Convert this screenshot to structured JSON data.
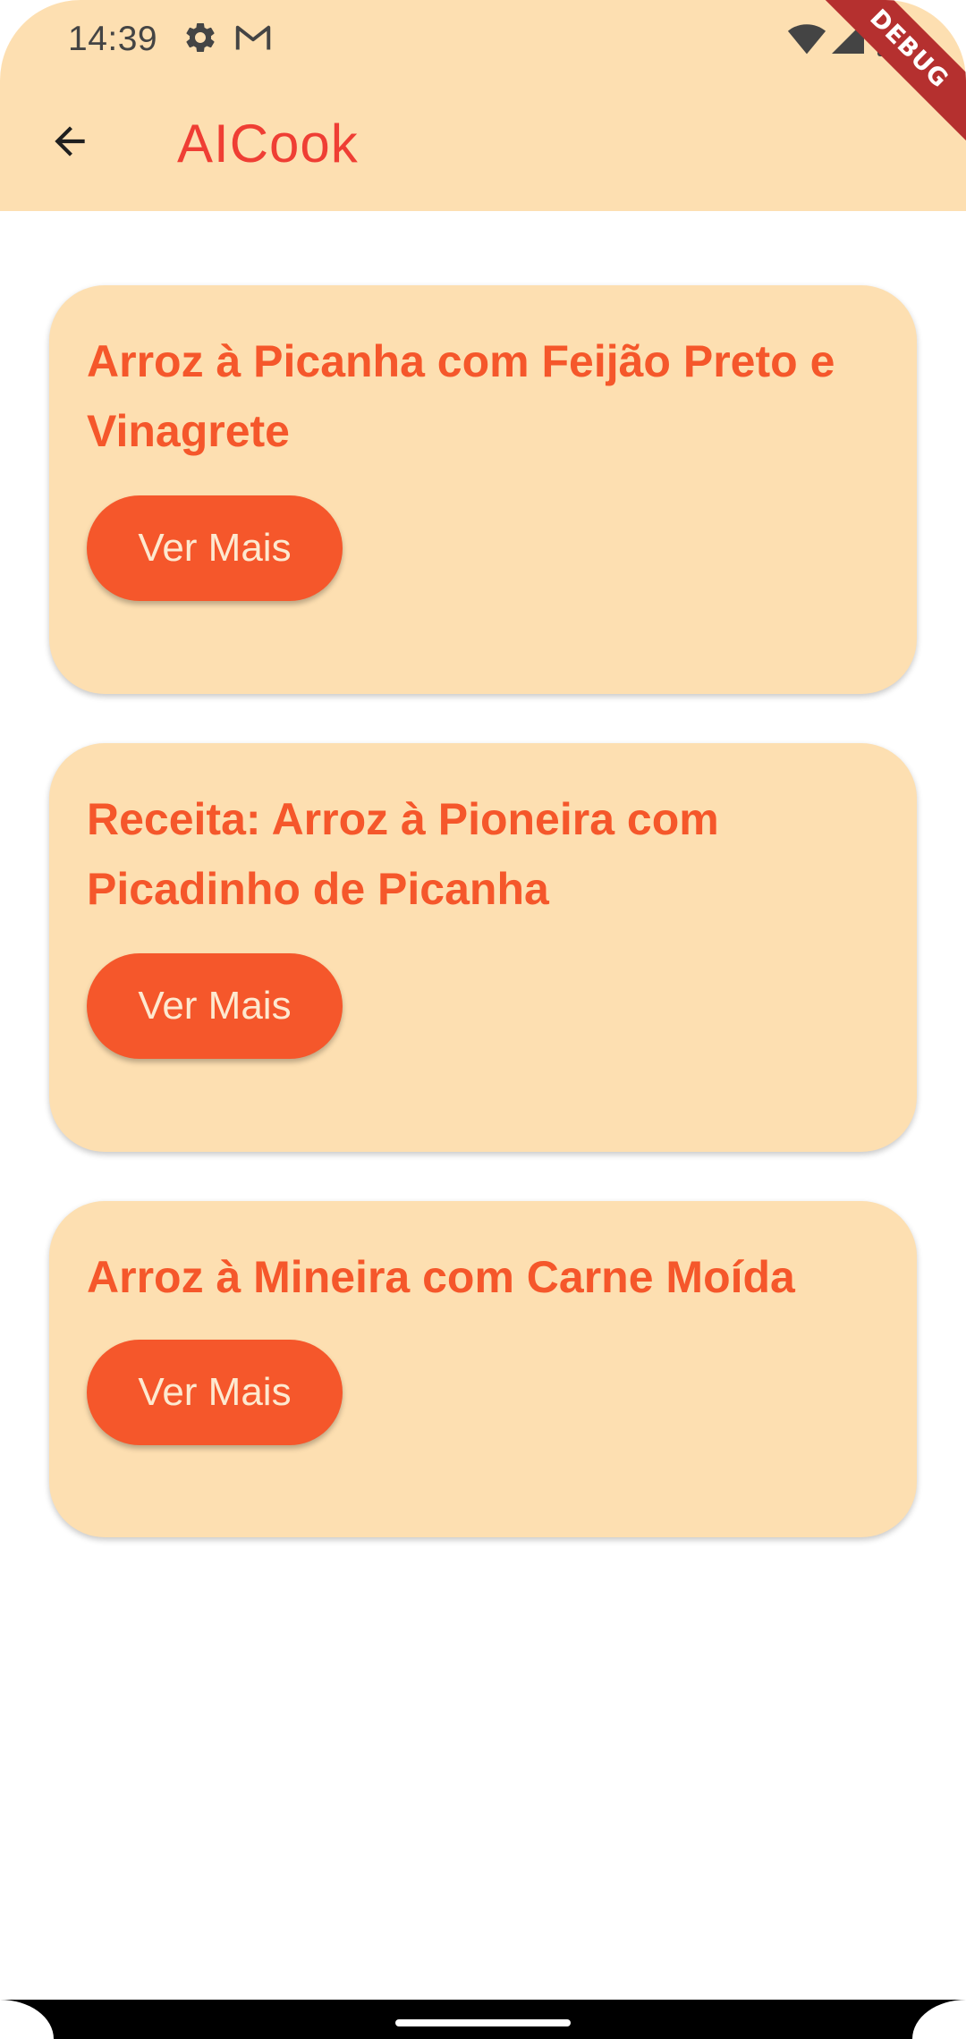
{
  "status_bar": {
    "time": "14:39",
    "icons": [
      "settings-icon",
      "gmail-icon",
      "wifi-icon",
      "signal-icon",
      "battery-icon"
    ]
  },
  "debug_banner": "DEBUG",
  "app_bar": {
    "back_icon": "arrow-back-icon",
    "title": "AICook"
  },
  "recipes": [
    {
      "title": "Arroz à Picanha com Feijão Preto e Vinagrete",
      "button_label": "Ver Mais"
    },
    {
      "title": "Receita: Arroz à Pioneira com Picadinho de Picanha",
      "button_label": "Ver Mais"
    },
    {
      "title": "Arroz à Mineira com Carne Moída",
      "button_label": "Ver Mais"
    }
  ],
  "colors": {
    "app_bar_bg": "#FDDFB1",
    "card_bg": "#FDDFB1",
    "accent": "#F5572B",
    "title_color": "#EF3E34",
    "button_text": "#FDE9D0"
  }
}
